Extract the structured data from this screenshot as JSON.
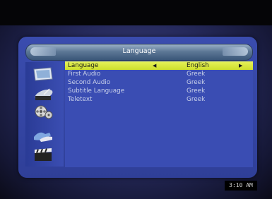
{
  "menu": {
    "title": "Language",
    "items": [
      {
        "label": "Language",
        "value": "English",
        "selected": true
      },
      {
        "label": "First Audio",
        "value": "Greek",
        "selected": false
      },
      {
        "label": "Second Audio",
        "value": "Greek",
        "selected": false
      },
      {
        "label": "Subtitle Language",
        "value": "Greek",
        "selected": false
      },
      {
        "label": "Teletext",
        "value": "Greek",
        "selected": false
      }
    ],
    "left_arrow": "◀",
    "right_arrow": "▶"
  },
  "sidebar": {
    "icons": [
      "tv-icon",
      "satellite-dish-icon",
      "film-reels-icon",
      "hands-icon",
      "clapperboard-icon"
    ]
  },
  "status": {
    "clock": "3:10 AM"
  },
  "colors": {
    "accent": "#d8e83a",
    "panel": "#3a4db3"
  }
}
